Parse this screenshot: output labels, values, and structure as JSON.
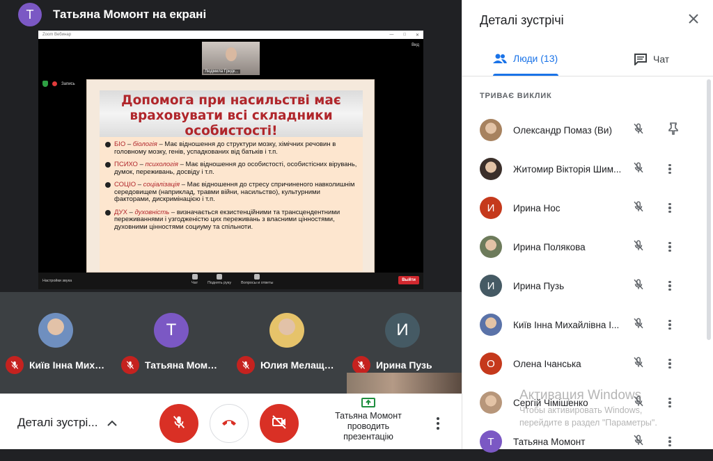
{
  "presenter": {
    "avatar_letter": "Т",
    "title": "Татьяна Момонт на екрані"
  },
  "zoom": {
    "window_title": "Zoom Вебинар",
    "view_label": "Вид",
    "thumb_label": "Людмила Гридк...",
    "record_label": "Запись",
    "audio_settings": "Настройки звука",
    "chat": "Чат",
    "raise_hand": "Поднять руку",
    "qa": "Вопросы и ответы",
    "exit": "Выйти"
  },
  "slide": {
    "title": "Допомога при насильстві має враховувати всі складники особистості!",
    "bullets": [
      {
        "key": "БІО",
        "em": "біологія",
        "text": " – Має відношення до структури мозку, хімічних речовин в головному мозку, генів, успадкованих від батьків і т.п."
      },
      {
        "key": "ПСИХО",
        "em": "психологія",
        "text": " – Має відношення до особистості, особистісних вірувань, думок, переживань, досвіду і т.п."
      },
      {
        "key": "СОЦІО",
        "em": "соціалізація",
        "text": " – Має відношення до стресу спричиненого  навколишнім середовищем (наприклад, травми війни, насильство), культурними факторами, дискримінацією і т.п."
      },
      {
        "key": "ДУХ",
        "em": "духовність",
        "text": " – визначається екзистенційними та трансцендентними переживаннями  і узгодженістю цих переживань з власними цінностями, духовними цінностями социуму та спільноти."
      }
    ]
  },
  "tiles": [
    {
      "name": "Київ Інна Миха...",
      "type": "photo",
      "color": "#6f8fbf"
    },
    {
      "name": "Татьяна Момонт",
      "type": "letter",
      "letter": "Т",
      "color": "#7b58c4"
    },
    {
      "name": "Юлия Мелащен...",
      "type": "photo",
      "color": "#e6c36a"
    },
    {
      "name": "Ирина Пузь",
      "type": "letter",
      "letter": "И",
      "color": "#455a64"
    }
  ],
  "controls": {
    "meeting_details": "Деталі зустрі...",
    "presenting_text": "Татьяна Момонт проводить презентацію"
  },
  "panel": {
    "title": "Деталі зустрічі",
    "tab_people": "Люди (13)",
    "tab_chat": "Чат",
    "section": "ТРИВАЄ ВИКЛИК",
    "participants": [
      {
        "name": "Олександр Помаз (Ви)",
        "letter": "",
        "color": "#a7825f",
        "action": "pin"
      },
      {
        "name": "Житомир Вікторія Шим...",
        "letter": "",
        "color": "#3b2f2a",
        "action": "more"
      },
      {
        "name": "Ирина Нос",
        "letter": "И",
        "color": "#c5391c",
        "action": "more"
      },
      {
        "name": "Ирина Полякова",
        "letter": "",
        "color": "#6d7b5b",
        "action": "more"
      },
      {
        "name": "Ирина Пузь",
        "letter": "И",
        "color": "#455a64",
        "action": "more"
      },
      {
        "name": "Київ Інна Михайлівна І...",
        "letter": "",
        "color": "#5a72a8",
        "action": "more"
      },
      {
        "name": "Олена Ічанська",
        "letter": "О",
        "color": "#c5391c",
        "action": "more"
      },
      {
        "name": "Сергій Чімішенко",
        "letter": "",
        "color": "#b7967a",
        "action": "more"
      },
      {
        "name": "Татьяна Момонт",
        "letter": "Т",
        "color": "#7b58c4",
        "action": "more"
      }
    ]
  },
  "watermark": {
    "line1": "Активация Windows",
    "line2": "Чтобы активировать Windows,",
    "line3": "перейдите в раздел \"Параметры\"."
  }
}
